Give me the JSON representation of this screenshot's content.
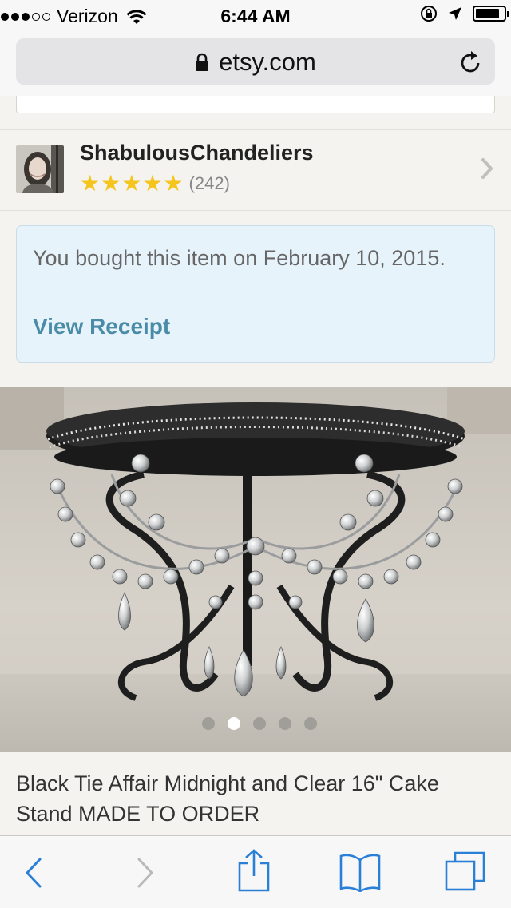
{
  "status_bar": {
    "carrier": "Verizon",
    "time": "6:44 AM",
    "signal_bars_filled": 3,
    "signal_bars_total": 5,
    "battery_level": 0.85
  },
  "browser": {
    "url": "etsy.com"
  },
  "shop": {
    "name": "ShabulousChandeliers",
    "rating_stars": 5,
    "review_count": "(242)"
  },
  "purchase_notice": {
    "text": "You bought this item on February 10, 2015.",
    "link_label": "View Receipt"
  },
  "photo_carousel": {
    "total": 5,
    "active_index": 1
  },
  "listing": {
    "title": "Black Tie Affair Midnight and Clear 16\" Cake Stand MADE TO ORDER"
  },
  "toolbar": {
    "icons": [
      "back-icon",
      "forward-icon",
      "share-icon",
      "bookmarks-icon",
      "tabs-icon"
    ]
  },
  "colors": {
    "link": "#4a8ba8",
    "star": "#f6c51d",
    "notice_bg": "#e6f3fa",
    "toolbar_icon": "#2a7fd6"
  }
}
